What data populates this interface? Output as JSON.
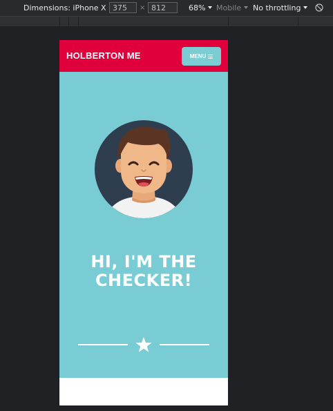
{
  "devtools": {
    "dimensions_label": "Dimensions: iPhone X",
    "width_value": "375",
    "times": "×",
    "height_value": "812",
    "zoom": "68%",
    "mobile_label": "Mobile",
    "throttling": "No throttling",
    "rotate_icon": "no-touch-icon"
  },
  "site": {
    "brand": "HOLBERTON ME",
    "menu_label": "MENU",
    "headline_line1": "HI, I'M THE",
    "headline_line2": "CHECKER!",
    "colors": {
      "header": "#e0003c",
      "hero": "#79ccd3",
      "menu_button": "#7bcdd3",
      "avatar_bg": "#2f3e4f"
    }
  }
}
